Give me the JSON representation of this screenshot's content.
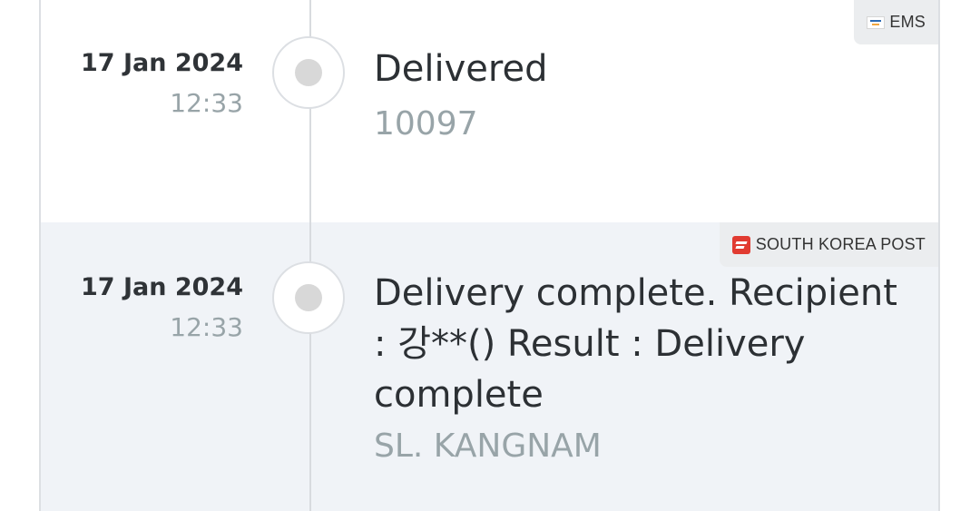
{
  "events": [
    {
      "carrier": {
        "name": "EMS",
        "logo_icon": "ems-logo-icon"
      },
      "date": "17 Jan 2024",
      "time": "12:33",
      "status": "Delivered",
      "location": "10097"
    },
    {
      "carrier": {
        "name": "SOUTH KOREA POST",
        "logo_icon": "korea-post-logo-icon"
      },
      "date": "17 Jan 2024",
      "time": "12:33",
      "status": "Delivery complete. Recipient : 강**() Result : Delivery complete",
      "location": "SL. KANGNAM"
    }
  ],
  "colors": {
    "highlight_row_bg": "#f0f3f7",
    "carrier_badge_bg": "#ebedef",
    "muted_text": "#98a4a8",
    "korea_post_red": "#e13b31"
  }
}
